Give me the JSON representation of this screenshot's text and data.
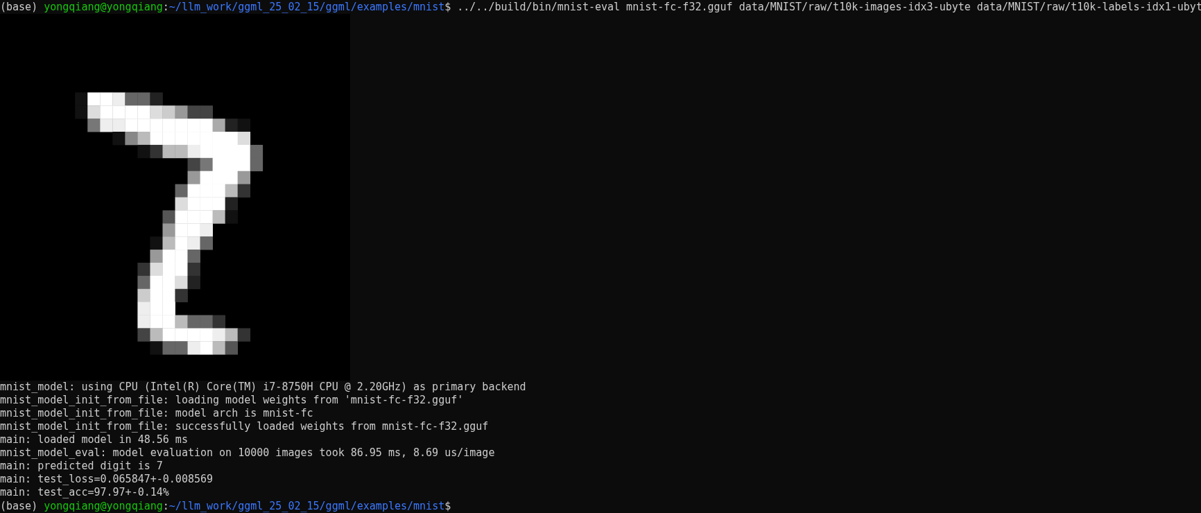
{
  "terminal": {
    "lines": [
      {
        "kind": "prompt",
        "env": "(base)",
        "user": "yongqiang@yongqiang",
        "separator": ":",
        "path": "~/llm_work/ggml_25_02_15/ggml/examples/mnist",
        "symbol": "$",
        "command": "../../build/bin/mnist-eval mnist-fc-f32.gguf data/MNIST/raw/t10k-images-idx3-ubyte data/MNIST/raw/t10k-labels-idx1-ubyt"
      },
      {
        "kind": "image"
      },
      {
        "kind": "output",
        "text": "mnist_model: using CPU (Intel(R) Core(TM) i7-8750H CPU @ 2.20GHz) as primary backend"
      },
      {
        "kind": "output",
        "text": "mnist_model_init_from_file: loading model weights from 'mnist-fc-f32.gguf'"
      },
      {
        "kind": "output",
        "text": "mnist_model_init_from_file: model arch is mnist-fc"
      },
      {
        "kind": "output",
        "text": "mnist_model_init_from_file: successfully loaded weights from mnist-fc-f32.gguf"
      },
      {
        "kind": "output",
        "text": "main: loaded model in 48.56 ms"
      },
      {
        "kind": "output",
        "text": "mnist_model_eval: model evaluation on 10000 images took 86.95 ms, 8.69 us/image"
      },
      {
        "kind": "output",
        "text": "main: predicted digit is 7"
      },
      {
        "kind": "output",
        "text": "main: test_loss=0.065847+-0.008569"
      },
      {
        "kind": "output",
        "text": "main: test_acc=97.97+-0.14%"
      },
      {
        "kind": "prompt",
        "env": "(base)",
        "user": "yongqiang@yongqiang",
        "separator": ":",
        "path": "~/llm_work/ggml_25_02_15/ggml/examples/mnist",
        "symbol": "$"
      }
    ]
  }
}
